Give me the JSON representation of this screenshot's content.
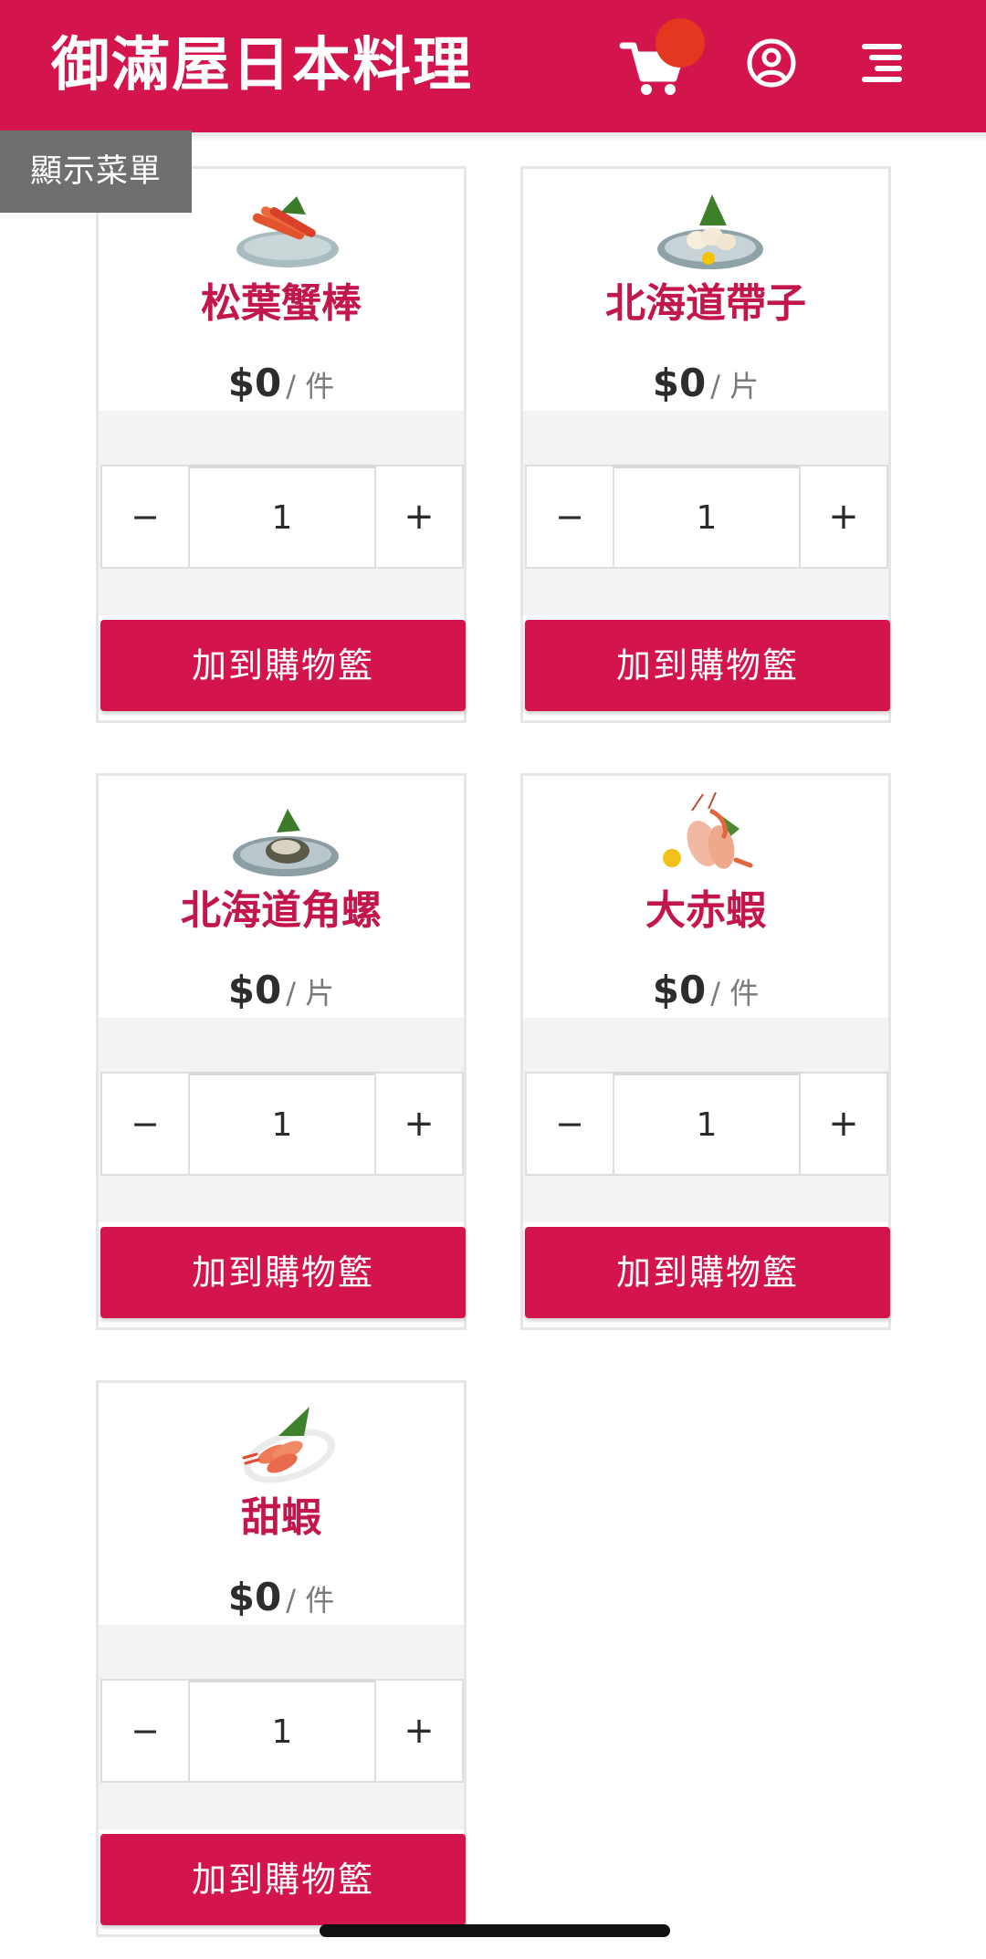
{
  "header": {
    "title": "御滿屋日本料理",
    "accent": "#d3154b",
    "badge_color": "#e3371f",
    "icons": [
      "cart-icon",
      "user-circle-icon",
      "menu-icon"
    ]
  },
  "show_menu_label": "顯示菜單",
  "products": [
    {
      "name": "松葉蟹棒",
      "price": "$0",
      "unit": "/ 件",
      "quantity": "1",
      "minus": "−",
      "plus": "+",
      "add_label": "加到購物籃"
    },
    {
      "name": "北海道帶子",
      "price": "$0",
      "unit": "/ 片",
      "quantity": "1",
      "minus": "−",
      "plus": "+",
      "add_label": "加到購物籃"
    },
    {
      "name": "北海道角螺",
      "price": "$0",
      "unit": "/ 片",
      "quantity": "1",
      "minus": "−",
      "plus": "+",
      "add_label": "加到購物籃"
    },
    {
      "name": "大赤蝦",
      "price": "$0",
      "unit": "/ 件",
      "quantity": "1",
      "minus": "−",
      "plus": "+",
      "add_label": "加到購物籃"
    },
    {
      "name": "甜蝦",
      "price": "$0",
      "unit": "/ 件",
      "quantity": "1",
      "minus": "−",
      "plus": "+",
      "add_label": "加到購物籃"
    }
  ]
}
